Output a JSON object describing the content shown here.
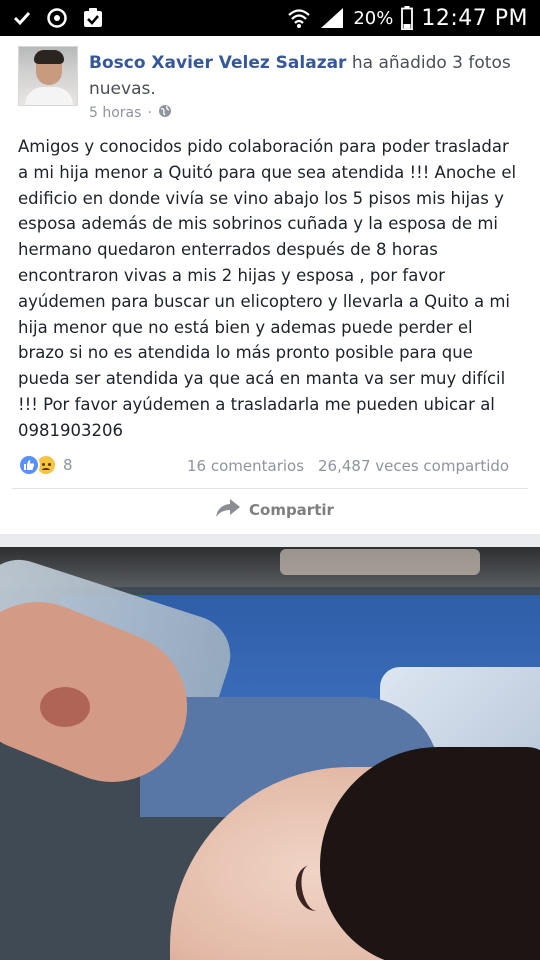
{
  "status_bar": {
    "icons_left": [
      "check-icon",
      "settings-circle-icon",
      "clipboard-check-icon"
    ],
    "battery": "20%",
    "time": "12:47 PM"
  },
  "post": {
    "author": "Bosco Xavier Velez Salazar",
    "action": "ha añadido 3 fotos nuevas.",
    "time_ago": "5 horas",
    "dot": "·",
    "privacy_icon": "globe-icon",
    "text": "Amigos y conocidos pido colaboración para poder trasladar a  mi hija menor a Quitó para que sea atendida !!! Anoche el edificio en donde vivía se vino abajo los 5 pisos mis hijas y esposa además de mis sobrinos cuñada y la esposa de mi hermano quedaron enterrados después de 8 horas encontraron vivas a mis 2 hijas y esposa , por favor ayúdemen para buscar un elicoptero y llevarla a Quito a mi hija menor que no está bien y ademas puede perder el brazo si no es atendida lo más pronto posible para que pueda ser atendida ya que acá en manta va ser muy difícil !!! Por favor ayúdemen a trasladarla me pueden ubicar al 0981903206",
    "reaction_count": "8",
    "comments": "16 comentarios",
    "shares": "26,487 veces compartido",
    "share_label": "Compartir"
  },
  "colors": {
    "author": "#365899",
    "secondary_text": "#90949c",
    "like_blue": "#5890ff",
    "sad_yellow": "#f7c343"
  }
}
